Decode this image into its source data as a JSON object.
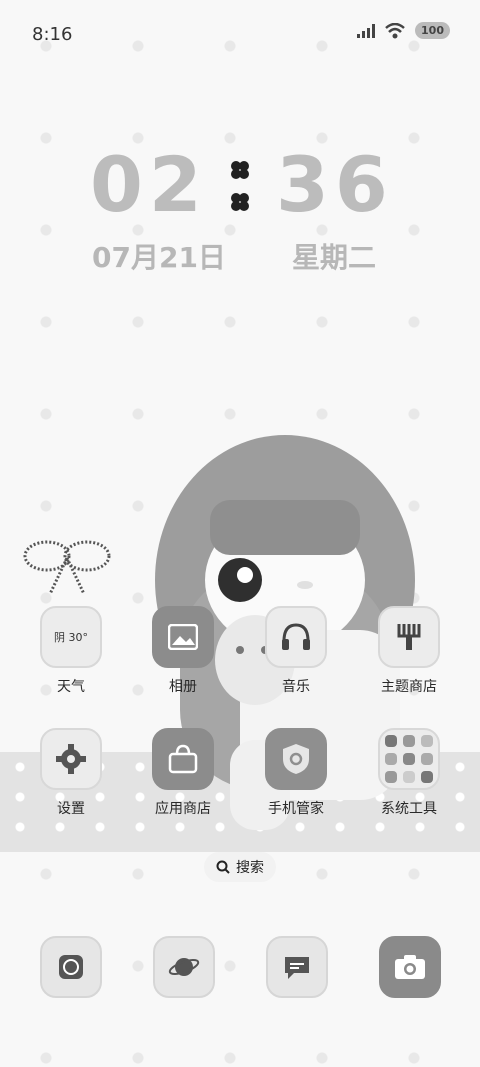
{
  "status_bar": {
    "time": "8:16",
    "battery": "100"
  },
  "clock": {
    "hours": "02",
    "minutes": "36",
    "date": "07月21日",
    "weekday": "星期二"
  },
  "apps": [
    {
      "label": "天气",
      "icon": "weather-icon",
      "weather_text": "阴 30°"
    },
    {
      "label": "相册",
      "icon": "gallery-icon"
    },
    {
      "label": "音乐",
      "icon": "headphones-icon"
    },
    {
      "label": "主题商店",
      "icon": "theme-store-icon"
    },
    {
      "label": "设置",
      "icon": "gear-icon"
    },
    {
      "label": "应用商店",
      "icon": "shopping-bag-icon"
    },
    {
      "label": "手机管家",
      "icon": "shield-icon"
    },
    {
      "label": "系统工具",
      "icon": "folder-icon"
    }
  ],
  "search": {
    "label": "搜索"
  },
  "dock": [
    {
      "icon": "phone-chat-icon"
    },
    {
      "icon": "browser-planet-icon"
    },
    {
      "icon": "message-icon"
    },
    {
      "icon": "camera-icon"
    }
  ]
}
